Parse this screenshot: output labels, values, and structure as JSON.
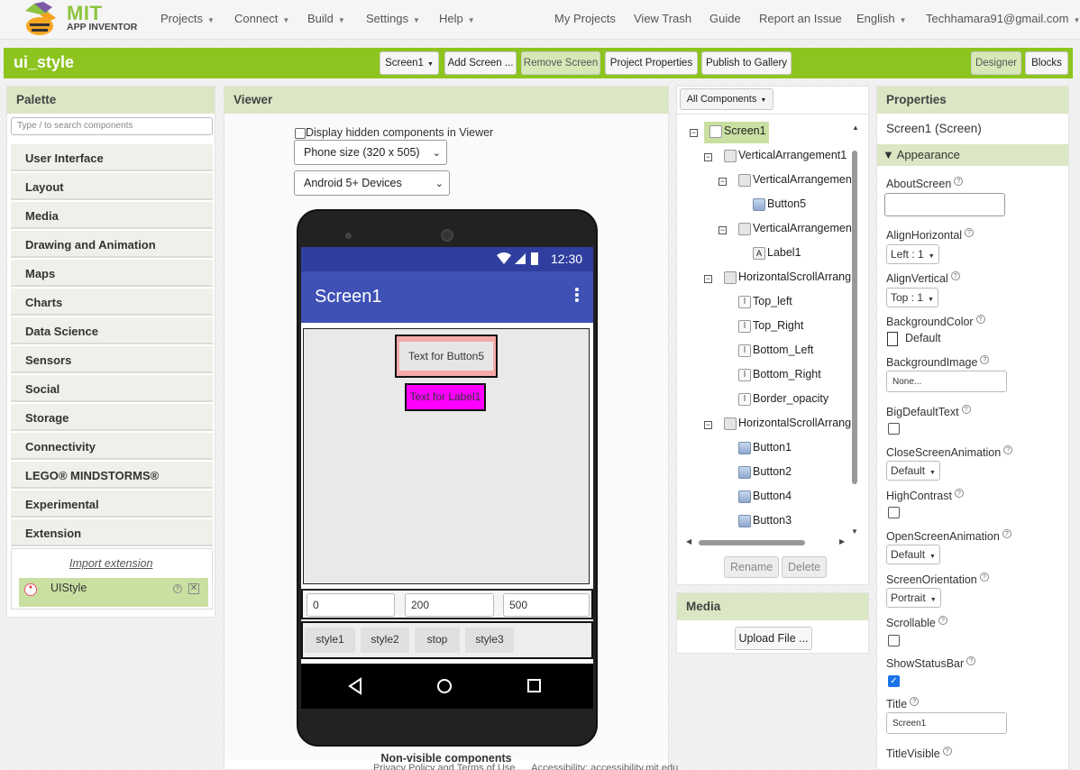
{
  "nav": {
    "logo_top": "MIT",
    "logo_bottom": "APP INVENTOR",
    "menus": [
      "Projects",
      "Connect",
      "Build",
      "Settings",
      "Help"
    ],
    "right_links": [
      "My Projects",
      "View Trash",
      "Guide",
      "Report an Issue",
      "English",
      "Techhamara91@gmail.com"
    ]
  },
  "toolbar": {
    "project_name": "ui_style",
    "screen_select": "Screen1",
    "add_screen": "Add Screen ...",
    "remove_screen": "Remove Screen",
    "project_properties": "Project Properties",
    "publish": "Publish to Gallery",
    "designer": "Designer",
    "blocks": "Blocks"
  },
  "palette": {
    "title": "Palette",
    "search_placeholder": "Type / to search components",
    "categories": [
      "User Interface",
      "Layout",
      "Media",
      "Drawing and Animation",
      "Maps",
      "Charts",
      "Data Science",
      "Sensors",
      "Social",
      "Storage",
      "Connectivity",
      "LEGO® MINDSTORMS®",
      "Experimental",
      "Extension"
    ],
    "import_extension": "Import extension",
    "extension_item": "UIStyle"
  },
  "viewer": {
    "title": "Viewer",
    "hidden_checkbox_label": "Display hidden components in Viewer",
    "phone_size": "Phone size (320 x 505)",
    "device": "Android 5+ Devices",
    "status_time": "12:30",
    "screen_title": "Screen1",
    "button5_text": "Text for Button5",
    "label1_text": "Text for Label1",
    "inputs": [
      "0",
      "200",
      "500"
    ],
    "style_buttons": [
      "style1",
      "style2",
      "stop",
      "style3"
    ],
    "nonvisible": "Non-visible components",
    "footer": "Privacy Policy and Terms of Use      Accessibility: accessibility.mit.edu"
  },
  "components": {
    "filter": "All Components",
    "tree": [
      {
        "label": "Screen1",
        "icon": "screen-icon"
      },
      {
        "label": "VerticalArrangement1",
        "icon": "vertical-arrangement-icon"
      },
      {
        "label": "VerticalArrangemen",
        "icon": "vertical-arrangement-icon"
      },
      {
        "label": "Button5",
        "icon": "button-icon"
      },
      {
        "label": "VerticalArrangemen",
        "icon": "vertical-arrangement-icon"
      },
      {
        "label": "Label1",
        "icon": "label-icon"
      },
      {
        "label": "HorizontalScrollArrang",
        "icon": "horizontal-scroll-icon"
      },
      {
        "label": "Top_left",
        "icon": "textbox-icon"
      },
      {
        "label": "Top_Right",
        "icon": "textbox-icon"
      },
      {
        "label": "Bottom_Left",
        "icon": "textbox-icon"
      },
      {
        "label": "Bottom_Right",
        "icon": "textbox-icon"
      },
      {
        "label": "Border_opacity",
        "icon": "textbox-icon"
      },
      {
        "label": "HorizontalScrollArrang",
        "icon": "horizontal-scroll-icon"
      },
      {
        "label": "Button1",
        "icon": "button-icon"
      },
      {
        "label": "Button2",
        "icon": "button-icon"
      },
      {
        "label": "Button4",
        "icon": "button-icon"
      },
      {
        "label": "Button3",
        "icon": "button-icon"
      }
    ],
    "rename": "Rename",
    "delete": "Delete"
  },
  "media": {
    "title": "Media",
    "upload": "Upload File ..."
  },
  "properties": {
    "title": "Properties",
    "subtitle": "Screen1 (Screen)",
    "section": "Appearance",
    "about_screen": "AboutScreen",
    "align_horizontal": "AlignHorizontal",
    "align_horizontal_value": "Left : 1",
    "align_vertical": "AlignVertical",
    "align_vertical_value": "Top : 1",
    "background_color": "BackgroundColor",
    "background_color_value": "Default",
    "background_image": "BackgroundImage",
    "background_image_value": "None...",
    "big_default_text": "BigDefaultText",
    "close_screen_animation": "CloseScreenAnimation",
    "close_screen_animation_value": "Default",
    "high_contrast": "HighContrast",
    "open_screen_animation": "OpenScreenAnimation",
    "open_screen_animation_value": "Default",
    "screen_orientation": "ScreenOrientation",
    "screen_orientation_value": "Portrait",
    "scrollable": "Scrollable",
    "show_status_bar": "ShowStatusBar",
    "title_label": "Title",
    "title_value": "Screen1",
    "title_visible": "TitleVisible"
  }
}
